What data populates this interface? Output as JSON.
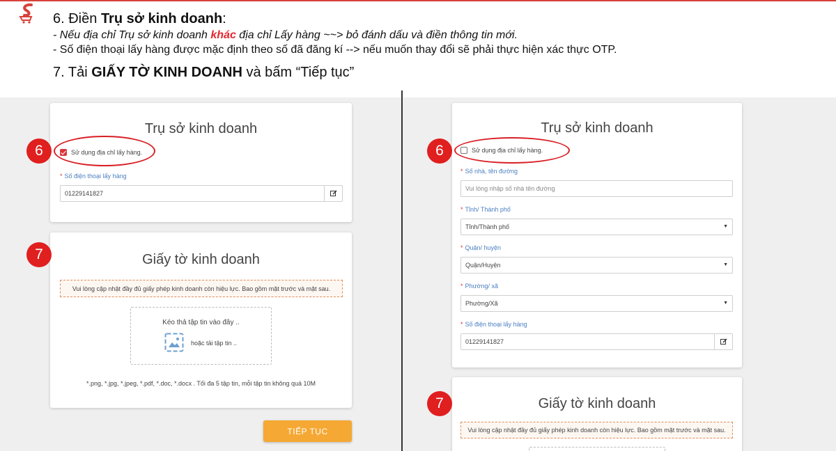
{
  "header": {
    "step6_prefix": "6. Điền ",
    "step6_bold": "Trụ sở kinh doanh",
    "step6_suffix": ":",
    "note1_a": "- Nếu địa chỉ Trụ sở kinh doanh ",
    "note1_highlight": "khác",
    "note1_b": " địa chỉ Lấy hàng ~~> bỏ đánh dấu và điền thông tin mới.",
    "note2": "- Số điện thoại lấy hàng được mặc định theo số đã đăng kí --> nếu muốn thay đổi sẽ phải thực hiện xác thực OTP.",
    "step7_prefix": "7. Tải ",
    "step7_bold": "GIẤY TỜ KINH DOANH",
    "step7_suffix": " và bấm “Tiếp tục”"
  },
  "badges": {
    "six": "6",
    "seven": "7"
  },
  "left": {
    "office_title": "Trụ sở kinh doanh",
    "checkbox_label": "Sử dụng địa chỉ lấy hàng.",
    "checkbox_checked": true,
    "phone_label": "Số điện thoại lấy hàng",
    "phone_value": "01229141827",
    "docs_title": "Giấy tờ kinh doanh",
    "notice": "Vui lòng cập nhật đầy đủ giấy phép kinh doanh còn hiệu lực. Bao gồm mặt trước và mặt sau.",
    "drop_text": "Kéo thả tập tin vào đây ..",
    "upload_text": "hoặc tải tập tin ..",
    "formats": "*.png, *.jpg, *.jpeg, *.pdf, *.doc, *.docx . Tối đa 5 tập tin, mỗi tập tin không quá 10M",
    "continue_label": "TIẾP TỤC"
  },
  "right": {
    "office_title": "Trụ sở kinh doanh",
    "checkbox_label": "Sử dụng địa chỉ lấy hàng.",
    "checkbox_checked": false,
    "street_label": "Số nhà, tên đường",
    "street_placeholder": "Vui lòng nhập số nhà tên đường",
    "city_label": "Tỉnh/ Thành phố",
    "city_value": "Tỉnh/Thành phố",
    "district_label": "Quận/ huyện",
    "district_value": "Quận/Huyện",
    "ward_label": "Phường/ xã",
    "ward_value": "Phường/Xã",
    "phone_label": "Số điện thoại lấy hàng",
    "phone_value": "01229141827",
    "docs_title": "Giấy tờ kinh doanh",
    "notice": "Vui lòng cập nhật đầy đủ giấy phép kinh doanh còn hiệu lực. Bao gồm mặt trước và mặt sau."
  },
  "colors": {
    "accent_red": "#e01f1f",
    "button_orange": "#f5a833",
    "label_blue": "#4a7fc1"
  },
  "icons": [
    "logo-icon",
    "edit-icon",
    "image-upload-icon",
    "caret-down-icon"
  ]
}
